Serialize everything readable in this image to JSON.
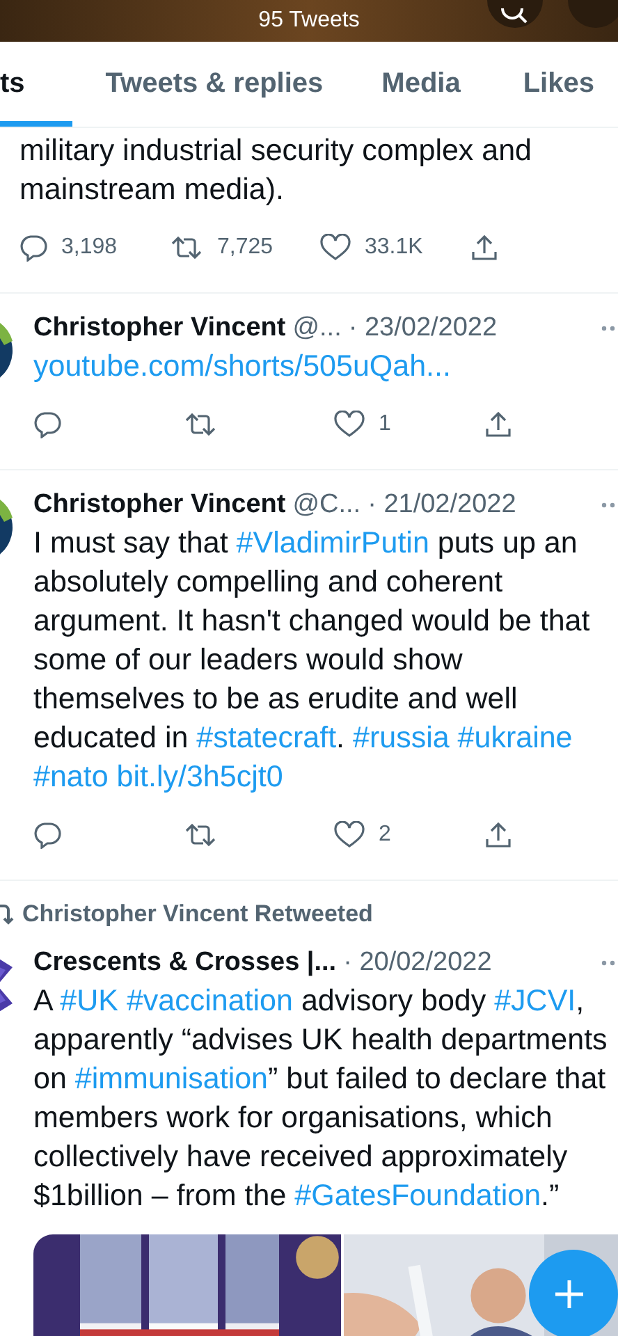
{
  "header": {
    "count_label": "95 Tweets"
  },
  "tabs": [
    {
      "label": "ts",
      "selected": true
    },
    {
      "label": "Tweets & replies",
      "selected": false
    },
    {
      "label": "Media",
      "selected": false
    },
    {
      "label": "Likes",
      "selected": false
    }
  ],
  "tweets": [
    {
      "body": [
        {
          "kind": "text",
          "text": "military industrial security complex and mainstream media)."
        }
      ],
      "actions": {
        "replies": "3,198",
        "retweets": "7,725",
        "likes": "33.1K"
      }
    },
    {
      "author": "Christopher Vincent",
      "handle": "@...",
      "date": "· 23/02/2022",
      "body": [
        {
          "kind": "url",
          "text": "youtube.com/shorts/505uQah..."
        }
      ],
      "actions": {
        "likes": "1"
      }
    },
    {
      "author": "Christopher Vincent",
      "handle": "@C...",
      "date": "· 21/02/2022",
      "body": [
        {
          "kind": "text",
          "text": "I must say that "
        },
        {
          "kind": "hashtag",
          "text": "#VladimirPutin"
        },
        {
          "kind": "text",
          "text": " puts up an absolutely compelling and coherent argument.  It hasn't changed would be that some of our leaders would show themselves to be as erudite and well educated in "
        },
        {
          "kind": "hashtag",
          "text": "#statecraft"
        },
        {
          "kind": "text",
          "text": ". "
        },
        {
          "kind": "hashtag",
          "text": "#russia",
          "space_after": true
        },
        {
          "kind": "hashtag",
          "text": "#ukraine",
          "space_after": true
        },
        {
          "kind": "hashtag",
          "text": "#nato",
          "space_after": true
        },
        {
          "kind": "url",
          "text": "bit.ly/3h5cjt0"
        }
      ],
      "actions": {
        "likes": "2"
      }
    },
    {
      "retweeted_by": "Christopher Vincent Retweeted",
      "author": "Crescents & Crosses |...",
      "date": "· 20/02/2022",
      "body": [
        {
          "kind": "text",
          "text": "A "
        },
        {
          "kind": "hashtag",
          "text": "#UK",
          "space_after": true
        },
        {
          "kind": "hashtag",
          "text": "#vaccination"
        },
        {
          "kind": "text",
          "text": " advisory body "
        },
        {
          "kind": "hashtag",
          "text": "#JCVI"
        },
        {
          "kind": "text",
          "text": ", apparently “advises UK health departments on "
        },
        {
          "kind": "hashtag",
          "text": "#immunisation"
        },
        {
          "kind": "text",
          "text": "” but  failed to declare that members work for organisations, which collectively have received approximately $1billion  – from the "
        },
        {
          "kind": "hashtag",
          "text": "#GatesFoundation"
        },
        {
          "kind": "text",
          "text": ".”"
        }
      ]
    }
  ]
}
